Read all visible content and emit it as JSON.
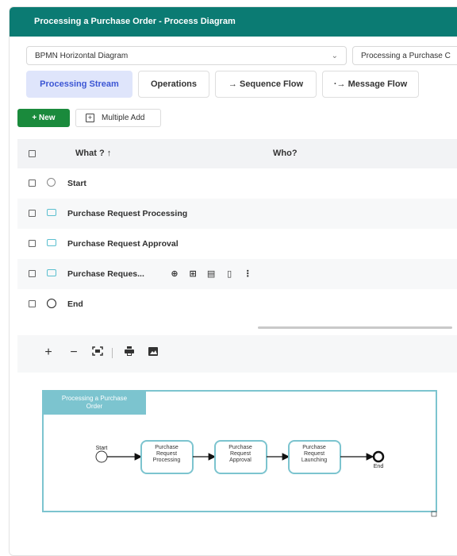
{
  "header": {
    "title": "Processing a Purchase Order - Process Diagram"
  },
  "selectors": {
    "diagram_type": "BPMN Horizontal Diagram",
    "process": "Processing a Purchase C"
  },
  "tabs": [
    {
      "label": "Processing Stream",
      "active": true
    },
    {
      "label": "Operations"
    },
    {
      "label": "→ Sequence Flow"
    },
    {
      "label": "·→ Message Flow"
    }
  ],
  "actions": {
    "new_label": "+ New",
    "multiple_add_label": "Multiple Add"
  },
  "table": {
    "headers": {
      "what": "What ? ↑",
      "who": "Who?"
    },
    "rows": [
      {
        "shape": "start-event",
        "label": "Start"
      },
      {
        "shape": "task",
        "label": "Purchase Request Processing"
      },
      {
        "shape": "task",
        "label": "Purchase Request Approval"
      },
      {
        "shape": "task",
        "label": "Purchase Reques..."
      },
      {
        "shape": "end-event",
        "label": "End"
      }
    ],
    "row_actions": [
      "add-circle-icon",
      "insert-icon",
      "edit-icon",
      "delete-icon",
      "more-icon"
    ]
  },
  "diagram_toolbar": [
    "zoom-in-icon",
    "zoom-out-icon",
    "fit-screen-icon",
    "print-icon",
    "image-icon"
  ],
  "diagram": {
    "pool_label": "Processing a Purchase Order",
    "start_label": "Start",
    "end_label": "End",
    "tasks": [
      "Purchase Request Processing",
      "Purchase Request Approval",
      "Purchase Request Launching"
    ],
    "colors": {
      "accent": "#7cc4cf",
      "header": "#0b7b73"
    }
  }
}
